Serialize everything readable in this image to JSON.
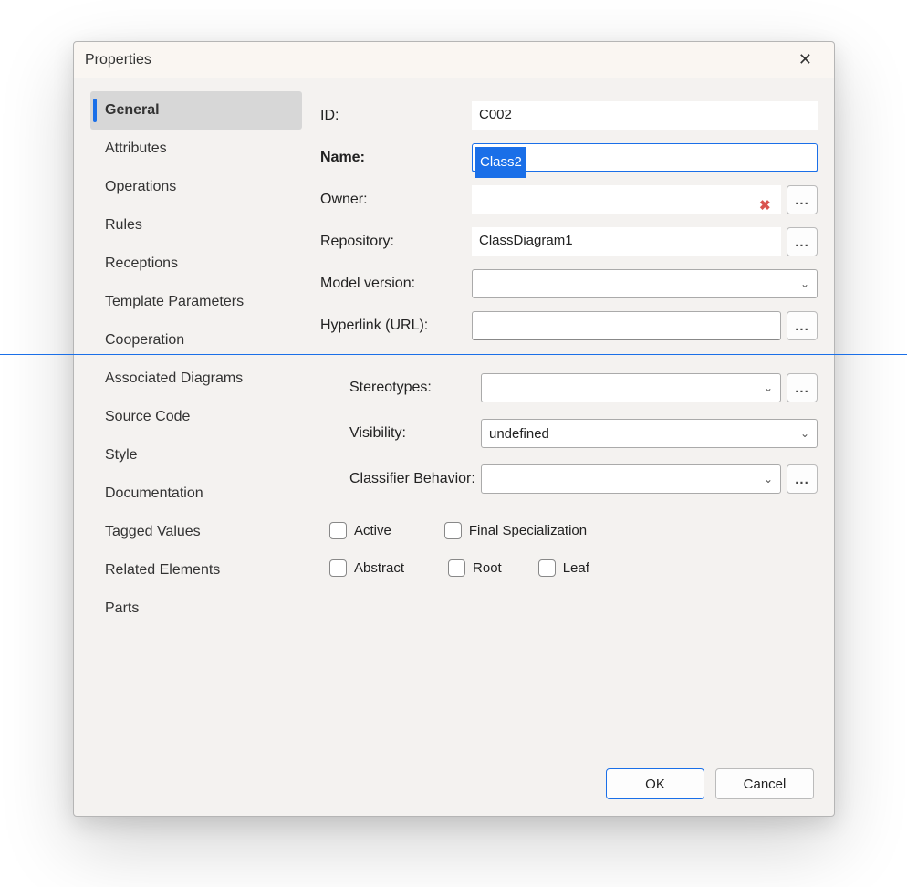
{
  "window": {
    "title": "Properties"
  },
  "sidebar": {
    "items": [
      {
        "label": "General",
        "active": true
      },
      {
        "label": "Attributes"
      },
      {
        "label": "Operations"
      },
      {
        "label": "Rules"
      },
      {
        "label": "Receptions"
      },
      {
        "label": "Template Parameters"
      },
      {
        "label": "Cooperation"
      },
      {
        "label": "Associated Diagrams"
      },
      {
        "label": "Source Code"
      },
      {
        "label": "Style"
      },
      {
        "label": "Documentation"
      },
      {
        "label": "Tagged Values"
      },
      {
        "label": "Related Elements"
      },
      {
        "label": "Parts"
      }
    ]
  },
  "form": {
    "id_label": "ID:",
    "id_value": "C002",
    "name_label": "Name:",
    "name_value": "Class2",
    "owner_label": "Owner:",
    "owner_value": "",
    "repository_label": "Repository:",
    "repository_value": "ClassDiagram1",
    "model_version_label": "Model version:",
    "model_version_value": "",
    "hyperlink_label": "Hyperlink (URL):",
    "hyperlink_value": "",
    "stereotypes_label": "Stereotypes:",
    "stereotypes_value": "",
    "visibility_label": "Visibility:",
    "visibility_value": "undefined",
    "classifier_label": "Classifier Behavior:",
    "classifier_value": "",
    "checkboxes": {
      "active": "Active",
      "final_specialization": "Final Specialization",
      "abstract": "Abstract",
      "root": "Root",
      "leaf": "Leaf"
    }
  },
  "buttons": {
    "ok": "OK",
    "cancel": "Cancel",
    "ellipsis": "..."
  },
  "icons": {
    "close": "✕",
    "delete": "✖",
    "chevron_down": "⌄"
  }
}
